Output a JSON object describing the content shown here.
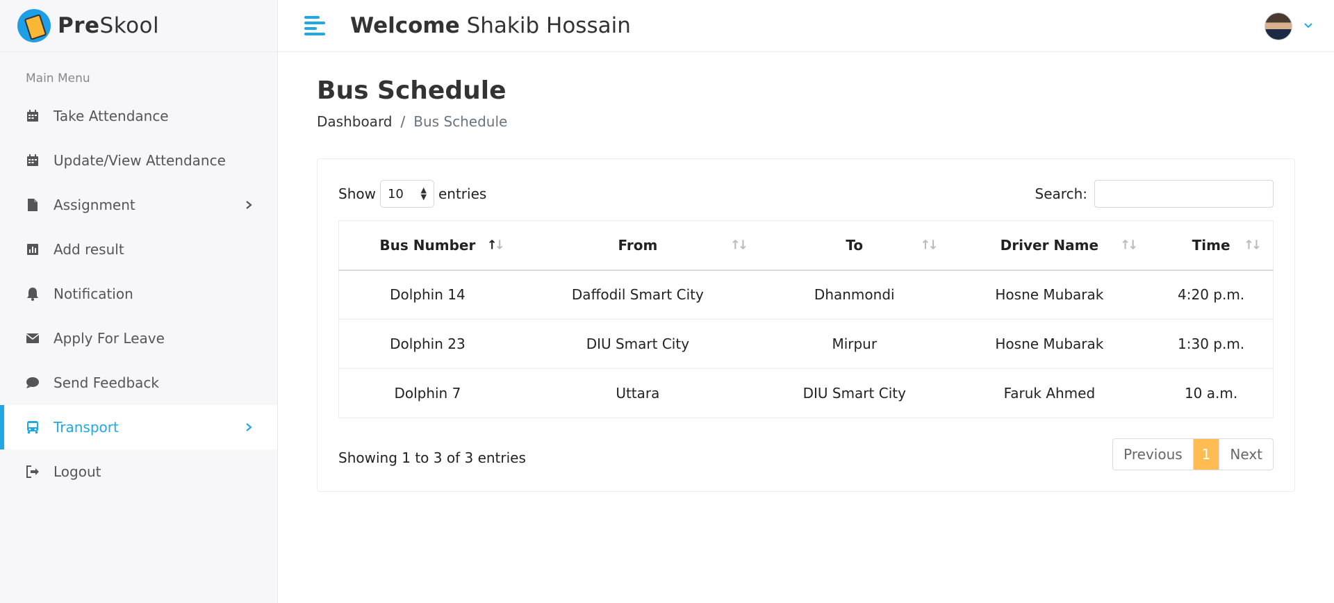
{
  "app": {
    "brand_prefix": "Pre",
    "brand_suffix": "Skool"
  },
  "header": {
    "welcome_label": "Welcome",
    "user_name": "Shakib Hossain"
  },
  "sidebar": {
    "menu_title": "Main Menu",
    "items": [
      {
        "label": "Take Attendance",
        "icon": "calendar-icon",
        "arrow": false,
        "active": false
      },
      {
        "label": "Update/View Attendance",
        "icon": "calendar-icon",
        "arrow": false,
        "active": false
      },
      {
        "label": "Assignment",
        "icon": "file-icon",
        "arrow": true,
        "active": false
      },
      {
        "label": "Add result",
        "icon": "bar-chart-icon",
        "arrow": false,
        "active": false
      },
      {
        "label": "Notification",
        "icon": "bell-icon",
        "arrow": false,
        "active": false
      },
      {
        "label": "Apply For Leave",
        "icon": "envelope-icon",
        "arrow": false,
        "active": false
      },
      {
        "label": "Send Feedback",
        "icon": "comment-icon",
        "arrow": false,
        "active": false
      },
      {
        "label": "Transport",
        "icon": "bus-icon",
        "arrow": true,
        "active": true
      },
      {
        "label": "Logout",
        "icon": "sign-out-icon",
        "arrow": false,
        "active": false
      }
    ]
  },
  "page": {
    "title": "Bus Schedule",
    "breadcrumb": {
      "home": "Dashboard",
      "separator": "/",
      "current": "Bus Schedule"
    }
  },
  "table_controls": {
    "show_label": "Show",
    "entries_value": "10",
    "entries_label": "entries",
    "search_label": "Search:",
    "search_value": ""
  },
  "table": {
    "columns": [
      "Bus Number",
      "From",
      "To",
      "Driver Name",
      "Time"
    ],
    "rows": [
      [
        "Dolphin 14",
        "Daffodil Smart City",
        "Dhanmondi",
        "Hosne Mubarak",
        "4:20 p.m."
      ],
      [
        "Dolphin 23",
        "DIU Smart City",
        "Mirpur",
        "Hosne Mubarak",
        "1:30 p.m."
      ],
      [
        "Dolphin 7",
        "Uttara",
        "DIU Smart City",
        "Faruk Ahmed",
        "10 a.m."
      ]
    ]
  },
  "footer": {
    "info": "Showing 1 to 3 of 3 entries",
    "prev": "Previous",
    "page": "1",
    "next": "Next"
  },
  "colors": {
    "accent": "#1fa7e6",
    "page_active": "#ffbc53"
  }
}
